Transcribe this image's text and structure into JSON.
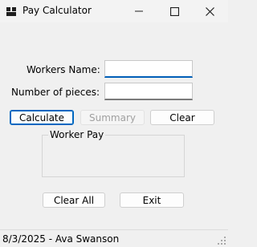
{
  "window": {
    "title": "Pay Calculator",
    "icons": {
      "app": "app-icon",
      "minimize": "minimize-icon",
      "maximize": "maximize-icon",
      "close": "close-icon"
    }
  },
  "form": {
    "workers_name_label": "Workers Name:",
    "workers_name_value": "",
    "pieces_label": "Number of pieces:",
    "pieces_value": ""
  },
  "buttons": {
    "calculate": "Calculate",
    "summary": "Summary",
    "clear": "Clear",
    "clear_all": "Clear All",
    "exit": "Exit"
  },
  "worker_pay": {
    "legend": "Worker Pay",
    "value": ""
  },
  "status": {
    "text": "8/3/2025 - Ava Swanson"
  },
  "colors": {
    "accent": "#0067c0",
    "background": "#f0f0f0"
  }
}
